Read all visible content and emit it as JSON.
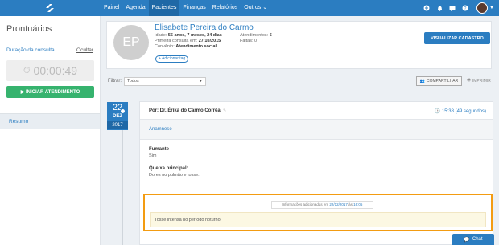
{
  "nav": {
    "items": [
      {
        "label": "Painel",
        "active": false
      },
      {
        "label": "Agenda",
        "active": false
      },
      {
        "label": "Pacientes",
        "active": true
      },
      {
        "label": "Finanças",
        "active": false
      },
      {
        "label": "Relatórios",
        "active": false
      },
      {
        "label": "Outros ⌄",
        "active": false
      }
    ],
    "icons": [
      "plus-circle-icon",
      "bell-icon",
      "chat-icon",
      "help-icon"
    ]
  },
  "sidebar": {
    "title": "Prontuários",
    "duration_label": "Duração da consulta",
    "hide_label": "Ocultar",
    "timer_value": "00:00:49",
    "start_button": "▶ INICIAR ATENDIMENTO",
    "resumo": "Resumo"
  },
  "patient": {
    "initials": "EP",
    "name": "Elisabete Pereira do Carmo",
    "age_label": "Idade:",
    "age_value": "55 anos, 7 meses, 24 dias",
    "first_label": "Primeira consulta em:",
    "first_value": "27/10/2015",
    "insurance_label": "Convênio:",
    "insurance_value": "Atendimento social",
    "appointments_label": "Atendimentos:",
    "appointments_value": "5",
    "absences_label": "Faltas:",
    "absences_value": "0",
    "add_tag": "+ Adicionar tag",
    "view_button": "VISUALIZAR CADASTRO"
  },
  "filter": {
    "label": "Filtrar:",
    "value": "Todos",
    "share": "COMPARTILHAR",
    "print": "IMPRIMIR"
  },
  "record": {
    "day": "22",
    "month": "DEZ",
    "year": "2017",
    "by": "Por: Dr. Érika do Carmo Corrêa",
    "time": "15:38 (49 segundos)",
    "section": "Anamnese",
    "fields": [
      {
        "label": "Fumante",
        "value": "Sim"
      },
      {
        "label": "Queixa principal:",
        "value": "Dores no pulmão e tosse."
      }
    ],
    "info_prefix": "Informações adicionadas em",
    "info_date": "22/12/2017",
    "info_mid": "às",
    "info_time": "16:05",
    "extra_note": "Tosse intensa no período noturno."
  },
  "chat": "Chat",
  "colors": {
    "primary": "#2b7dc1",
    "success": "#36b36e",
    "highlight": "#f39c12"
  }
}
